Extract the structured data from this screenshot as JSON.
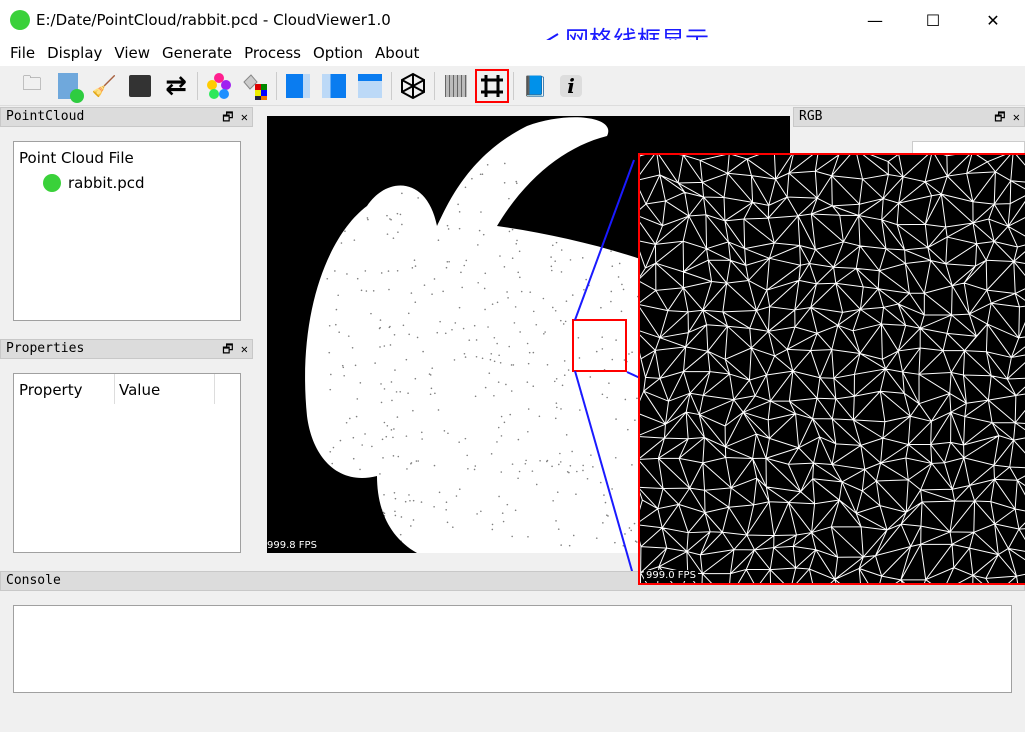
{
  "window": {
    "title": "E:/Date/PointCloud/rabbit.pcd - CloudViewer1.0",
    "minimize": "—",
    "maximize": "☐",
    "close": "✕"
  },
  "menu": [
    "File",
    "Display",
    "View",
    "Generate",
    "Process",
    "Option",
    "About"
  ],
  "annotation": "网格线框显示",
  "docks": {
    "pointcloud": "PointCloud",
    "properties": "Properties",
    "rgb": "RGB",
    "console": "Console",
    "float": "🗗",
    "close": "✕"
  },
  "tree": {
    "root": "Point Cloud File",
    "child": "rabbit.pcd"
  },
  "props": {
    "col1": "Property",
    "col2": "Value"
  },
  "viewer": {
    "fps": "999.8 FPS",
    "inset_fps": "999.0 FPS"
  },
  "colors": {
    "accent": "#ff0000",
    "arrow": "#1a1aff"
  }
}
